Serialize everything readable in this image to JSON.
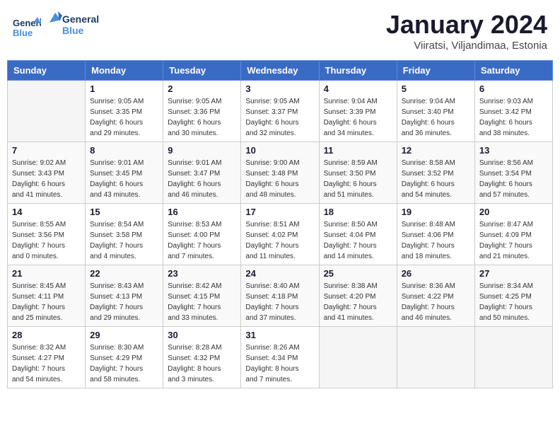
{
  "header": {
    "logo_general": "General",
    "logo_blue": "Blue",
    "title": "January 2024",
    "subtitle": "Viiratsi, Viljandimaa, Estonia"
  },
  "weekdays": [
    "Sunday",
    "Monday",
    "Tuesday",
    "Wednesday",
    "Thursday",
    "Friday",
    "Saturday"
  ],
  "weeks": [
    [
      {
        "day": "",
        "info": ""
      },
      {
        "day": "1",
        "info": "Sunrise: 9:05 AM\nSunset: 3:35 PM\nDaylight: 6 hours\nand 29 minutes."
      },
      {
        "day": "2",
        "info": "Sunrise: 9:05 AM\nSunset: 3:36 PM\nDaylight: 6 hours\nand 30 minutes."
      },
      {
        "day": "3",
        "info": "Sunrise: 9:05 AM\nSunset: 3:37 PM\nDaylight: 6 hours\nand 32 minutes."
      },
      {
        "day": "4",
        "info": "Sunrise: 9:04 AM\nSunset: 3:39 PM\nDaylight: 6 hours\nand 34 minutes."
      },
      {
        "day": "5",
        "info": "Sunrise: 9:04 AM\nSunset: 3:40 PM\nDaylight: 6 hours\nand 36 minutes."
      },
      {
        "day": "6",
        "info": "Sunrise: 9:03 AM\nSunset: 3:42 PM\nDaylight: 6 hours\nand 38 minutes."
      }
    ],
    [
      {
        "day": "7",
        "info": "Sunrise: 9:02 AM\nSunset: 3:43 PM\nDaylight: 6 hours\nand 41 minutes."
      },
      {
        "day": "8",
        "info": "Sunrise: 9:01 AM\nSunset: 3:45 PM\nDaylight: 6 hours\nand 43 minutes."
      },
      {
        "day": "9",
        "info": "Sunrise: 9:01 AM\nSunset: 3:47 PM\nDaylight: 6 hours\nand 46 minutes."
      },
      {
        "day": "10",
        "info": "Sunrise: 9:00 AM\nSunset: 3:48 PM\nDaylight: 6 hours\nand 48 minutes."
      },
      {
        "day": "11",
        "info": "Sunrise: 8:59 AM\nSunset: 3:50 PM\nDaylight: 6 hours\nand 51 minutes."
      },
      {
        "day": "12",
        "info": "Sunrise: 8:58 AM\nSunset: 3:52 PM\nDaylight: 6 hours\nand 54 minutes."
      },
      {
        "day": "13",
        "info": "Sunrise: 8:56 AM\nSunset: 3:54 PM\nDaylight: 6 hours\nand 57 minutes."
      }
    ],
    [
      {
        "day": "14",
        "info": "Sunrise: 8:55 AM\nSunset: 3:56 PM\nDaylight: 7 hours\nand 0 minutes."
      },
      {
        "day": "15",
        "info": "Sunrise: 8:54 AM\nSunset: 3:58 PM\nDaylight: 7 hours\nand 4 minutes."
      },
      {
        "day": "16",
        "info": "Sunrise: 8:53 AM\nSunset: 4:00 PM\nDaylight: 7 hours\nand 7 minutes."
      },
      {
        "day": "17",
        "info": "Sunrise: 8:51 AM\nSunset: 4:02 PM\nDaylight: 7 hours\nand 11 minutes."
      },
      {
        "day": "18",
        "info": "Sunrise: 8:50 AM\nSunset: 4:04 PM\nDaylight: 7 hours\nand 14 minutes."
      },
      {
        "day": "19",
        "info": "Sunrise: 8:48 AM\nSunset: 4:06 PM\nDaylight: 7 hours\nand 18 minutes."
      },
      {
        "day": "20",
        "info": "Sunrise: 8:47 AM\nSunset: 4:09 PM\nDaylight: 7 hours\nand 21 minutes."
      }
    ],
    [
      {
        "day": "21",
        "info": "Sunrise: 8:45 AM\nSunset: 4:11 PM\nDaylight: 7 hours\nand 25 minutes."
      },
      {
        "day": "22",
        "info": "Sunrise: 8:43 AM\nSunset: 4:13 PM\nDaylight: 7 hours\nand 29 minutes."
      },
      {
        "day": "23",
        "info": "Sunrise: 8:42 AM\nSunset: 4:15 PM\nDaylight: 7 hours\nand 33 minutes."
      },
      {
        "day": "24",
        "info": "Sunrise: 8:40 AM\nSunset: 4:18 PM\nDaylight: 7 hours\nand 37 minutes."
      },
      {
        "day": "25",
        "info": "Sunrise: 8:38 AM\nSunset: 4:20 PM\nDaylight: 7 hours\nand 41 minutes."
      },
      {
        "day": "26",
        "info": "Sunrise: 8:36 AM\nSunset: 4:22 PM\nDaylight: 7 hours\nand 46 minutes."
      },
      {
        "day": "27",
        "info": "Sunrise: 8:34 AM\nSunset: 4:25 PM\nDaylight: 7 hours\nand 50 minutes."
      }
    ],
    [
      {
        "day": "28",
        "info": "Sunrise: 8:32 AM\nSunset: 4:27 PM\nDaylight: 7 hours\nand 54 minutes."
      },
      {
        "day": "29",
        "info": "Sunrise: 8:30 AM\nSunset: 4:29 PM\nDaylight: 7 hours\nand 58 minutes."
      },
      {
        "day": "30",
        "info": "Sunrise: 8:28 AM\nSunset: 4:32 PM\nDaylight: 8 hours\nand 3 minutes."
      },
      {
        "day": "31",
        "info": "Sunrise: 8:26 AM\nSunset: 4:34 PM\nDaylight: 8 hours\nand 7 minutes."
      },
      {
        "day": "",
        "info": ""
      },
      {
        "day": "",
        "info": ""
      },
      {
        "day": "",
        "info": ""
      }
    ]
  ]
}
